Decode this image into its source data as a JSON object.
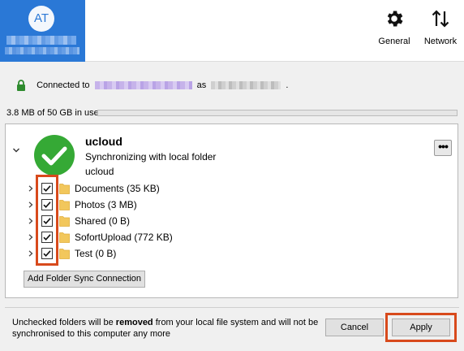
{
  "account": {
    "initials": "AT",
    "accent": "#2a78d6"
  },
  "toolbar": {
    "general_label": "General",
    "network_label": "Network",
    "general_icon": "gear-icon",
    "network_icon": "up-down-arrows-icon"
  },
  "connection": {
    "prefix": "Connected to",
    "middle": "as",
    "suffix": "."
  },
  "quota": {
    "text": "3.8 MB of 50 GB in use",
    "used_fraction": 0
  },
  "folder": {
    "name": "ucloud",
    "status": "Synchronizing with local folder",
    "local": "ucloud",
    "more_label": "•••",
    "status_color": "#35a935"
  },
  "subfolders": [
    {
      "label": "Documents (35 KB)",
      "checked": true
    },
    {
      "label": "Photos (3 MB)",
      "checked": true
    },
    {
      "label": "Shared (0 B)",
      "checked": true
    },
    {
      "label": "SofortUpload (772 KB)",
      "checked": true
    },
    {
      "label": "Test (0 B)",
      "checked": true
    }
  ],
  "add_button_label": "Add Folder Sync Connection",
  "footer": {
    "warning_pre": "Unchecked folders will be",
    "warning_bold": "removed",
    "warning_post": "from your local file system and will not be synchronised to this computer any more",
    "cancel_label": "Cancel",
    "apply_label": "Apply",
    "highlight_color": "#d84a1c"
  }
}
